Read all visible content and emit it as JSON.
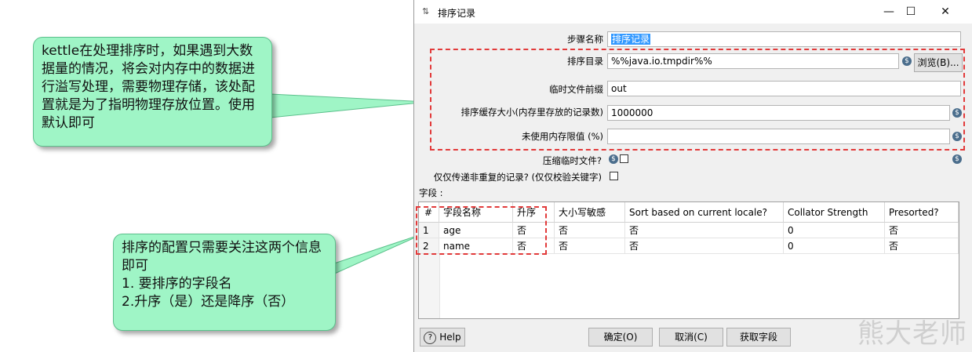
{
  "dialog": {
    "title": "排序记录",
    "controls": {
      "minimize": "—",
      "maximize": "☐",
      "close": "✕"
    }
  },
  "form": {
    "step_name_label": "步骤名称",
    "step_name_value": "排序记录",
    "sort_dir_label": "排序目录",
    "sort_dir_value": "%%java.io.tmpdir%%",
    "browse_label": "浏览(B)...",
    "temp_prefix_label": "临时文件前缀",
    "temp_prefix_value": "out",
    "cache_size_label": "排序缓存大小(内存里存放的记录数)",
    "cache_size_value": "1000000",
    "free_mem_label": "未使用内存限值 (%)",
    "free_mem_value": "",
    "compress_label": "压缩临时文件?",
    "unique_label": "仅仅传递非重复的记录? (仅仅校验关键字)",
    "var_icon": "$"
  },
  "fields": {
    "section_label": "字段 :",
    "columns": [
      "#",
      "字段名称",
      "升序",
      "大小写敏感",
      "Sort based on current locale?",
      "Collator Strength",
      "Presorted?"
    ],
    "rows": [
      [
        "1",
        "age",
        "否",
        "否",
        "否",
        "0",
        "否"
      ],
      [
        "2",
        "name",
        "否",
        "否",
        "否",
        "0",
        "否"
      ]
    ]
  },
  "buttons": {
    "help": "Help",
    "ok": "确定(O)",
    "cancel": "取消(C)",
    "get_fields": "获取字段"
  },
  "annotations": {
    "top": "kettle在处理排序时，如果遇到大数据量的情况，将会对内存中的数据进行溢写处理，需要物理存储，该处配置就是为了指明物理存放位置。使用默认即可",
    "bottom_lines": [
      "排序的配置只需要关注这两个信息即可",
      "1. 要排序的字段名",
      "2.升序（是）还是降序（否）"
    ]
  },
  "watermark": "熊大老师",
  "colors": {
    "callout_fill": "#9ff5c6",
    "dash_red": "#e23a3a",
    "selection": "#3399ff"
  }
}
